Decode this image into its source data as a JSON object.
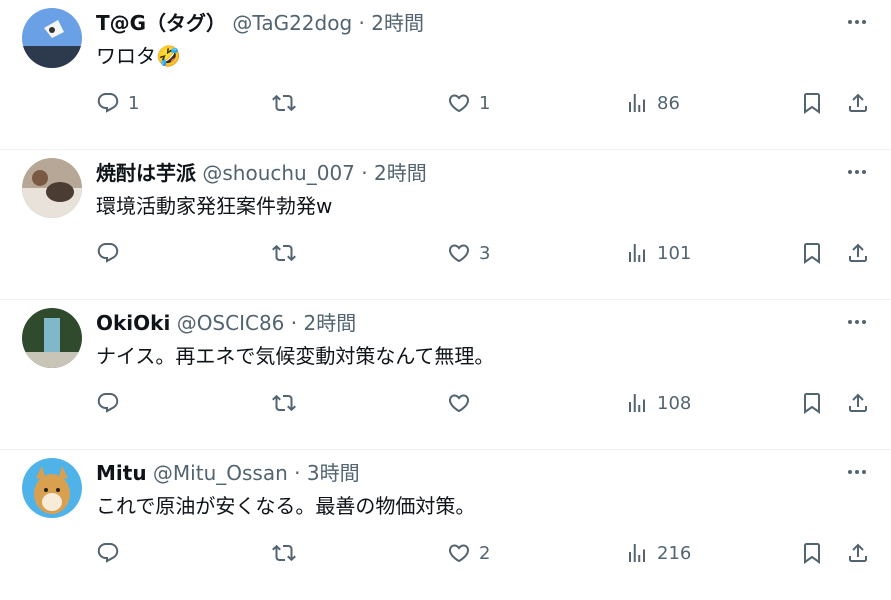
{
  "tweets": [
    {
      "name": "T@G（タグ）",
      "handle": "@TaG22dog",
      "dot": "·",
      "time": "2時間",
      "text": "ワロタ🤣",
      "replies": "1",
      "retweets": "",
      "likes": "1",
      "views": "86",
      "avatar_color": "#5a8fd8"
    },
    {
      "name": "焼酎は芋派",
      "handle": "@shouchu_007",
      "dot": "·",
      "time": "2時間",
      "text": "環境活動家発狂案件勃発w",
      "replies": "",
      "retweets": "",
      "likes": "3",
      "views": "101",
      "avatar_color": "#8c7a6b"
    },
    {
      "name": "OkiOki",
      "handle": "@OSCIC86",
      "dot": "·",
      "time": "2時間",
      "text": "ナイス。再エネで気候変動対策なんて無理。",
      "replies": "",
      "retweets": "",
      "likes": "",
      "views": "108",
      "avatar_color": "#3f5a3a"
    },
    {
      "name": "Mitu",
      "handle": "@Mitu_Ossan",
      "dot": "·",
      "time": "3時間",
      "text": "これで原油が安くなる。最善の物価対策。",
      "replies": "",
      "retweets": "",
      "likes": "2",
      "views": "216",
      "avatar_color": "#49b0e8"
    }
  ],
  "icons": {
    "more": "more-icon",
    "reply": "reply-icon",
    "retweet": "retweet-icon",
    "like": "heart-icon",
    "views": "views-icon",
    "bookmark": "bookmark-icon",
    "share": "share-icon"
  },
  "colors": {
    "text": "#0f1419",
    "secondary": "#536471",
    "separator": "#eff3f4"
  }
}
